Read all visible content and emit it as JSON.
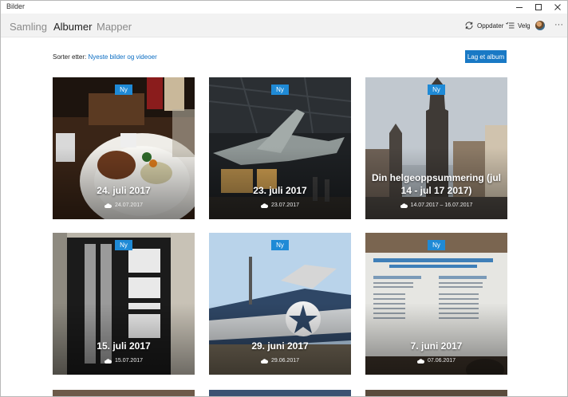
{
  "window": {
    "title": "Bilder"
  },
  "nav": {
    "tabs": [
      {
        "label": "Samling",
        "active": false
      },
      {
        "label": "Albumer",
        "active": true
      },
      {
        "label": "Mapper",
        "active": false
      }
    ]
  },
  "toolbar": {
    "refresh_label": "Oppdater",
    "select_label": "Velg",
    "more_label": "···"
  },
  "sort": {
    "prefix": "Sorter etter:",
    "value": "Nyeste bilder og videoer"
  },
  "create_album_label": "Lag et album",
  "albums": [
    {
      "badge": "Ny",
      "title": "24. juli 2017",
      "date": "24.07.2017"
    },
    {
      "badge": "Ny",
      "title": "23. juli 2017",
      "date": "23.07.2017"
    },
    {
      "badge": "Ny",
      "title": "Din helgeoppsummering (jul 14 - jul 17 2017)",
      "date": "14.07.2017 – 16.07.2017"
    },
    {
      "badge": "Ny",
      "title": "15. juli 2017",
      "date": "15.07.2017"
    },
    {
      "badge": "Ny",
      "title": "29. juni 2017",
      "date": "29.06.2017"
    },
    {
      "badge": "Ny",
      "title": "7. juni 2017",
      "date": "07.06.2017"
    }
  ],
  "icons": {
    "refresh": "refresh-icon",
    "select": "select-list-icon",
    "cloud": "cloud-icon"
  },
  "colors": {
    "accent": "#1979c5",
    "badge": "#1f8ad6",
    "link": "#0a6cc2",
    "header_bg": "#f2f2f2"
  }
}
